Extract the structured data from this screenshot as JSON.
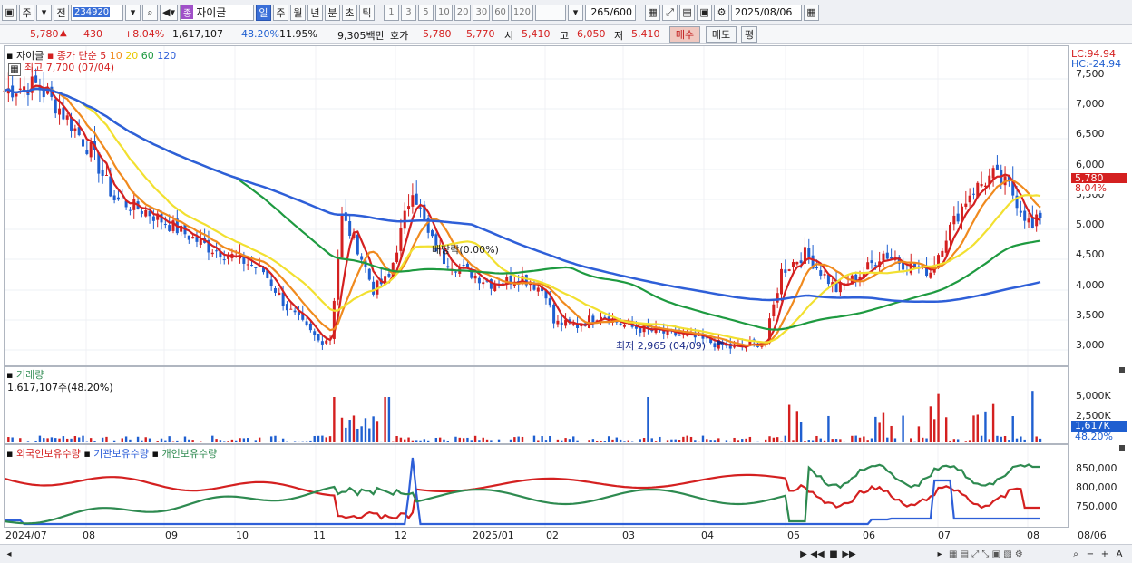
{
  "toolbar": {
    "mode_1": "주",
    "mode_2": "전",
    "stock_code": "234920",
    "stock_tag": "종",
    "stock_name": "자이글",
    "periods": [
      "일",
      "주",
      "월",
      "년",
      "분",
      "초",
      "틱"
    ],
    "active_period": "일",
    "intervals": [
      "1",
      "3",
      "5",
      "10",
      "20",
      "30",
      "60",
      "120"
    ],
    "bar_count": "265",
    "bar_max": "/600",
    "date": "2025/08/06"
  },
  "quote": {
    "price": "5,780",
    "change": "430",
    "change_pct": "+8.04%",
    "volume": "1,617,107",
    "vol_ratio": "48.20%",
    "turnover_rate": "11.95%",
    "amount": "9,305백만",
    "hoga_label": "호가",
    "ask": "5,780",
    "bid": "5,770",
    "open_label": "시",
    "open": "5,410",
    "high_label": "고",
    "high": "6,050",
    "low_label": "저",
    "low": "5,410",
    "buy_button": "매수",
    "sell_button": "매도",
    "eval_button": "평"
  },
  "price_panel": {
    "legend_name": "자이글",
    "legend_ma_label": "종가 단순",
    "ma_periods": [
      "5",
      "10",
      "20",
      "60",
      "120"
    ],
    "ma_colors": [
      "#d42020",
      "#f08a1e",
      "#f2e030",
      "#1e9a40",
      "#2e5fd8"
    ],
    "high_annotation": "최고 7,700 (07/04)",
    "low_annotation": "최저 2,965 (04/09)",
    "dividend_annotation": "배당락(0.00%)",
    "lc_label": "LC:94.94",
    "hc_label": "HC:-24.94",
    "current_price_tag": "5,780",
    "current_pct_tag": "8.04%",
    "y_ticks": [
      "7,500",
      "7,000",
      "6,500",
      "6,000",
      "5,500",
      "5,000",
      "4,500",
      "4,000",
      "3,500",
      "3,000"
    ]
  },
  "volume_panel": {
    "title": "거래량",
    "value": "1,617,107주(48.20%)",
    "y_ticks": [
      "5,000K",
      "2,500K"
    ],
    "current_tag": "1,617K",
    "current_pct": "48.20%"
  },
  "holdings_panel": {
    "series": [
      "외국인보유수량",
      "기관보유수량",
      "개인보유수량"
    ],
    "series_colors": [
      "#d42020",
      "#2e5fd8",
      "#2e8a50"
    ],
    "y_ticks": [
      "850,000",
      "800,000",
      "750,000"
    ]
  },
  "x_axis": {
    "labels": [
      "2024/07",
      "08",
      "09",
      "10",
      "11",
      "12",
      "2025/01",
      "02",
      "03",
      "04",
      "05",
      "06",
      "07",
      "08"
    ],
    "end_label": "08/06"
  },
  "colors": {
    "up": "#d42020",
    "down": "#1f5fd0"
  }
}
